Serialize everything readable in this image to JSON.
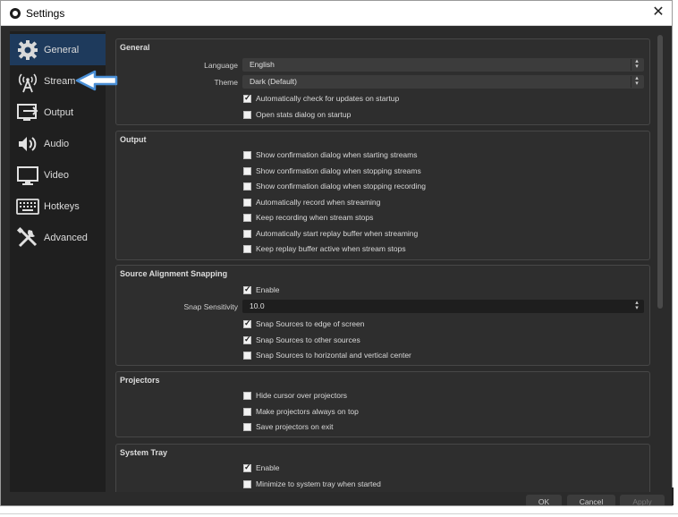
{
  "window": {
    "title": "Settings",
    "close_symbol": "✕"
  },
  "sidebar": {
    "items": [
      {
        "label": "General",
        "icon": "gear-icon",
        "selected": true
      },
      {
        "label": "Stream",
        "icon": "broadcast-icon",
        "selected": false
      },
      {
        "label": "Output",
        "icon": "output-icon",
        "selected": false
      },
      {
        "label": "Audio",
        "icon": "speaker-icon",
        "selected": false
      },
      {
        "label": "Video",
        "icon": "monitor-icon",
        "selected": false
      },
      {
        "label": "Hotkeys",
        "icon": "keyboard-icon",
        "selected": false
      },
      {
        "label": "Advanced",
        "icon": "tools-icon",
        "selected": false
      }
    ]
  },
  "general": {
    "title": "General",
    "language_label": "Language",
    "language_value": "English",
    "theme_label": "Theme",
    "theme_value": "Dark (Default)",
    "checks": [
      {
        "label": "Automatically check for updates on startup",
        "checked": true
      },
      {
        "label": "Open stats dialog on startup",
        "checked": false
      }
    ]
  },
  "output": {
    "title": "Output",
    "checks": [
      {
        "label": "Show confirmation dialog when starting streams",
        "checked": false
      },
      {
        "label": "Show confirmation dialog when stopping streams",
        "checked": false
      },
      {
        "label": "Show confirmation dialog when stopping recording",
        "checked": false
      },
      {
        "label": "Automatically record when streaming",
        "checked": false
      },
      {
        "label": "Keep recording when stream stops",
        "checked": false
      },
      {
        "label": "Automatically start replay buffer when streaming",
        "checked": false
      },
      {
        "label": "Keep replay buffer active when stream stops",
        "checked": false
      }
    ]
  },
  "snapping": {
    "title": "Source Alignment Snapping",
    "enable": {
      "label": "Enable",
      "checked": true
    },
    "sensitivity_label": "Snap Sensitivity",
    "sensitivity_value": "10.0",
    "checks": [
      {
        "label": "Snap Sources to edge of screen",
        "checked": true
      },
      {
        "label": "Snap Sources to other sources",
        "checked": true
      },
      {
        "label": "Snap Sources to horizontal and vertical center",
        "checked": false
      }
    ]
  },
  "projectors": {
    "title": "Projectors",
    "checks": [
      {
        "label": "Hide cursor over projectors",
        "checked": false
      },
      {
        "label": "Make projectors always on top",
        "checked": false
      },
      {
        "label": "Save projectors on exit",
        "checked": false
      }
    ]
  },
  "tray": {
    "title": "System Tray",
    "checks": [
      {
        "label": "Enable",
        "checked": true
      },
      {
        "label": "Minimize to system tray when started",
        "checked": false
      }
    ]
  },
  "footer": {
    "ok": "OK",
    "cancel": "Cancel",
    "apply": "Apply"
  },
  "colors": {
    "selected_bg": "#1e3a5c",
    "annotation_arrow": "#4a8fd6"
  }
}
